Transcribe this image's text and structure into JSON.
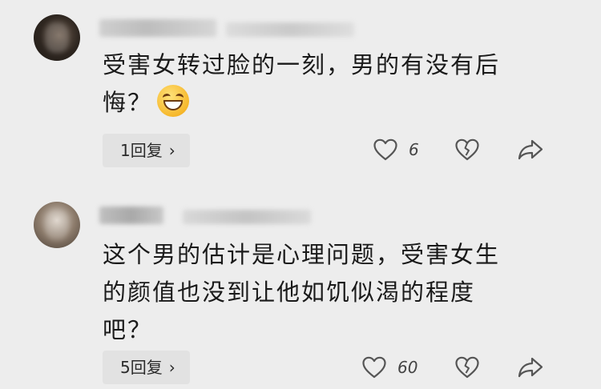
{
  "comments": [
    {
      "avatar_icon": "user-avatar-icon",
      "text_lines": [
        "受害女转过脸的一刻，男的有没有后",
        "悔？"
      ],
      "emoji": "laughing-emoji",
      "reply_label": "1回复",
      "reply_chevron": "›",
      "likes": "6"
    },
    {
      "avatar_icon": "user-avatar-icon",
      "text_lines": [
        "这个男的估计是心理问题，受害女生",
        "的颜值也没到让他如饥似渴的程度",
        "吧？"
      ],
      "reply_label": "5回复",
      "reply_chevron": "›",
      "likes": "60"
    }
  ],
  "colors": {
    "background": "#ededed",
    "reply_bg": "#e2e2e2",
    "icon": "#555555",
    "text": "#1a1a1a"
  }
}
